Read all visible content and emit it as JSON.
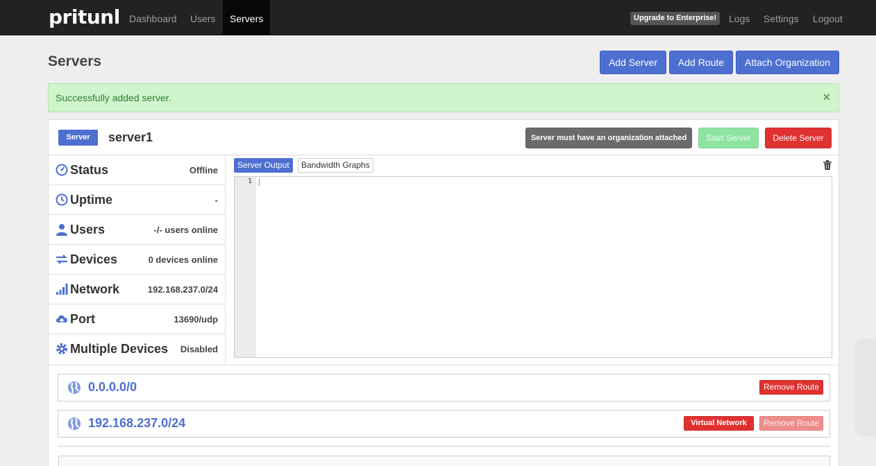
{
  "navbar": {
    "brand": "pritunl",
    "left_links": [
      "Dashboard",
      "Users",
      "Servers"
    ],
    "active": "Servers",
    "upgrade": "Upgrade to Enterprise!",
    "right_links": [
      "Logs",
      "Settings",
      "Logout"
    ]
  },
  "page": {
    "title": "Servers",
    "buttons": {
      "add_server": "Add Server",
      "add_route": "Add Route",
      "attach_org": "Attach Organization"
    }
  },
  "alert": {
    "text": "Successfully added server.",
    "close": "×"
  },
  "server": {
    "badge": "Server",
    "name": "server1",
    "warning": "Server must have an organization attached",
    "start": "Start Server",
    "delete": "Delete Server",
    "stats": [
      {
        "label": "Status",
        "value": "Offline",
        "icon": "dashboard-icon"
      },
      {
        "label": "Uptime",
        "value": "-",
        "icon": "clock-icon"
      },
      {
        "label": "Users",
        "value": "-/- users online",
        "icon": "user-icon"
      },
      {
        "label": "Devices",
        "value": "0 devices online",
        "icon": "transfer-icon"
      },
      {
        "label": "Network",
        "value": "192.168.237.0/24",
        "icon": "signal-icon"
      },
      {
        "label": "Port",
        "value": "13690/udp",
        "icon": "cloud-upload-icon"
      },
      {
        "label": "Multiple Devices",
        "value": "Disabled",
        "icon": "cog-icon"
      }
    ],
    "tabs": {
      "output": "Server Output",
      "bandwidth": "Bandwidth Graphs"
    },
    "editor": {
      "line_number": "1"
    },
    "routes": [
      {
        "network": "0.0.0.0/0",
        "remove": "Remove Route"
      },
      {
        "network": "192.168.237.0/24",
        "virtual": "Virtual Network",
        "remove": "Remove Route"
      }
    ]
  },
  "colors": {
    "primary": "#4d6fd0",
    "danger": "#e03131",
    "success_bg": "#d0f5cc",
    "navbar": "#222222"
  }
}
